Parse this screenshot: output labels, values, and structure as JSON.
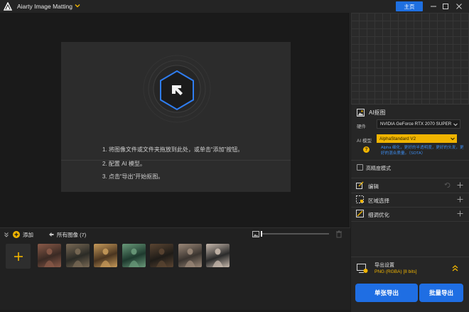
{
  "window": {
    "title": "Aiarty Image Matting",
    "home_button": "主页",
    "controls": [
      "minimize-icon",
      "maximize-icon",
      "close-icon"
    ]
  },
  "canvas": {
    "steps": [
      "1. 将图像文件或文件夹拖放到此处，或单击“添加”按钮。",
      "2. 配置 AI 模型。",
      "3. 点击“导出”开始抠图。"
    ]
  },
  "thumbbar": {
    "add_label": "添加",
    "all_images_label": "所有图像 (7)",
    "zoom_level": 0.0,
    "thumbnails": [
      {
        "icon": "thumbnail-jellyfish",
        "c1": "#3a2a24",
        "c2": "#8a5a48"
      },
      {
        "icon": "thumbnail-city",
        "c1": "#2b2b26",
        "c2": "#7a6a55"
      },
      {
        "icon": "thumbnail-bicycle",
        "c1": "#4a3520",
        "c2": "#c79a5a"
      },
      {
        "icon": "thumbnail-girl-red-dress",
        "c1": "#1e3a2e",
        "c2": "#6a9a7a"
      },
      {
        "icon": "thumbnail-woman-pumpkin",
        "c1": "#1f1c18",
        "c2": "#5b4532"
      },
      {
        "icon": "thumbnail-woman-floral",
        "c1": "#3b3530",
        "c2": "#9b8878"
      },
      {
        "icon": "thumbnail-woman-flowers",
        "c1": "#2a2a2a",
        "c2": "#c8b9ad"
      }
    ]
  },
  "sidebar": {
    "ai_matting": {
      "title": "AI抠图",
      "hardware_label": "硬件",
      "hardware_value": "NVIDIA GeForce RTX 2070 SUPER",
      "model_label": "AI 模型",
      "model_value": "AlphaStandard  V2",
      "model_desc": "Alpha 细化，更好的半透明度，更好的头发，更好的混合质量。（SOTA）",
      "high_precision_label": "高精度模式",
      "high_precision_checked": false
    },
    "sections": [
      {
        "label": "编辑",
        "icon": "edit-icon",
        "has_undo": true
      },
      {
        "label": "区域选择",
        "icon": "region-select-icon",
        "has_undo": false
      },
      {
        "label": "细调优化",
        "icon": "refine-icon",
        "has_undo": false
      }
    ],
    "export": {
      "title": "导出设置",
      "format": "PNG (RGBA) [8 bits]",
      "single_button": "单张导出",
      "batch_button": "批量导出"
    }
  },
  "colors": {
    "accent_blue": "#1f6ee3",
    "accent_yellow": "#f0b400",
    "link_blue": "#3d8df0"
  }
}
